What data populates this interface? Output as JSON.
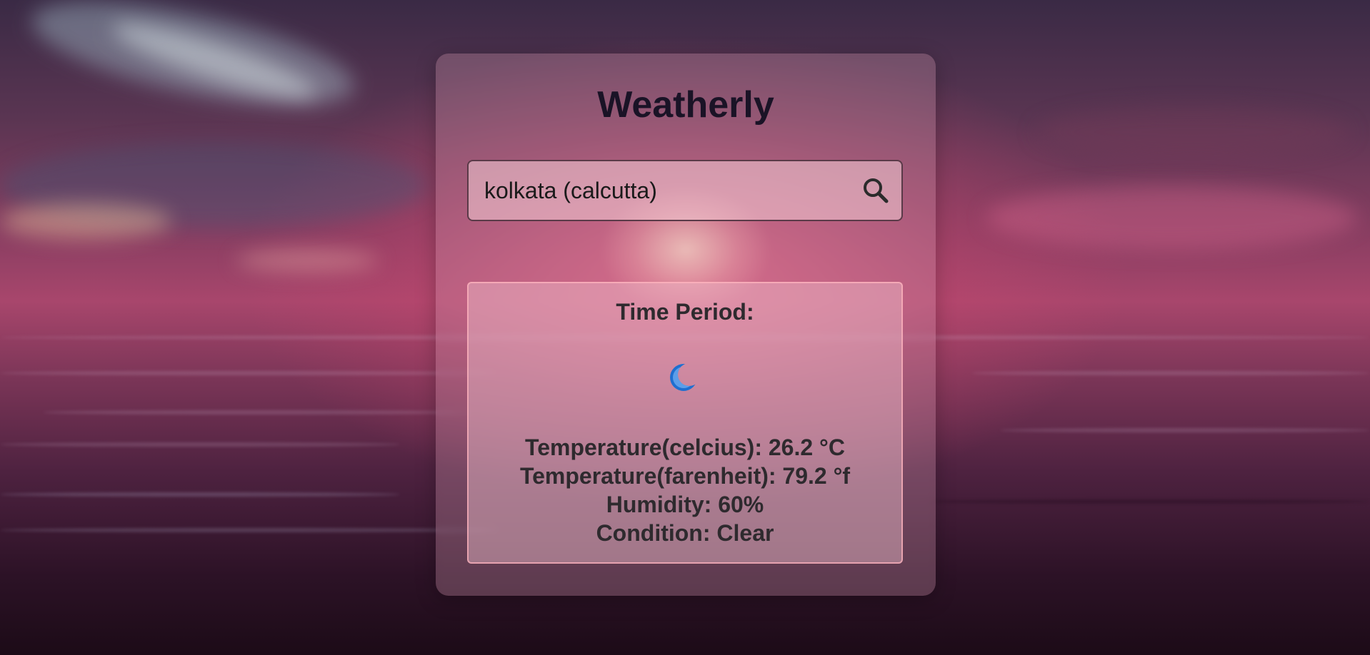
{
  "app": {
    "title": "Weatherly"
  },
  "search": {
    "value": "kolkata (calcutta)",
    "icon": "search-icon"
  },
  "result": {
    "time_period_label": "Time Period:",
    "condition_icon": "crescent-moon-icon",
    "temperature_celsius": "Temperature(celcius): 26.2 °C",
    "temperature_fahrenheit": "Temperature(farenheit): 79.2 °f",
    "humidity": "Humidity: 60%",
    "condition": "Condition: Clear"
  },
  "colors": {
    "title_text": "#1a1326",
    "body_text": "#2e2a2e",
    "moon_icon": "#1e6fd0"
  }
}
